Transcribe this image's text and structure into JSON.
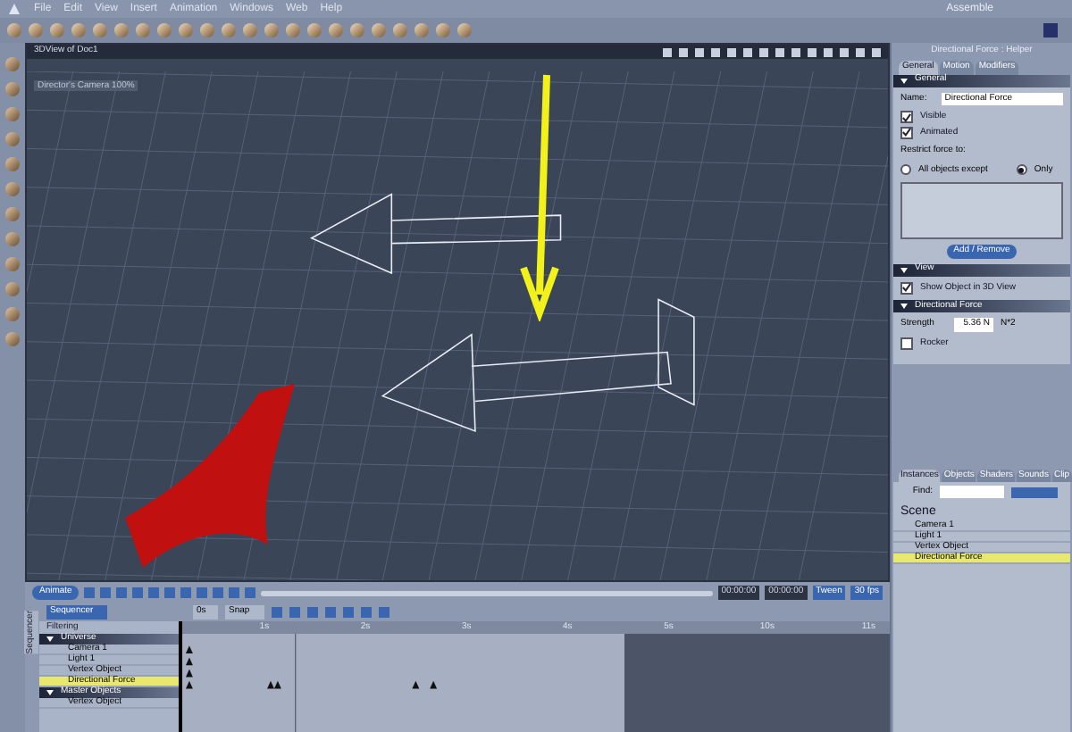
{
  "menu": [
    "File",
    "Edit",
    "View",
    "Insert",
    "Animation",
    "Windows",
    "Web",
    "Help"
  ],
  "room": "Assemble",
  "viewport": {
    "title": "3DView of Doc1",
    "camera": "Director's Camera 100%"
  },
  "properties": {
    "title": "Directional Force : Helper",
    "tabs": [
      {
        "label": "General",
        "selected": true
      },
      {
        "label": "Motion",
        "selected": false
      },
      {
        "label": "Modifiers",
        "selected": false
      }
    ],
    "general": {
      "heading": "General",
      "name_label": "Name:",
      "name_value": "Directional Force",
      "checks": [
        {
          "label": "Visible",
          "checked": true
        },
        {
          "label": "Animated",
          "checked": true
        }
      ],
      "restrict_label": "Restrict force to:",
      "radios": [
        {
          "label": "All objects except",
          "selected": false
        },
        {
          "label": "Only",
          "selected": true
        }
      ],
      "button": "Add / Remove"
    },
    "view": {
      "heading": "View",
      "checks": [
        {
          "label": "Show Object in 3D View",
          "checked": true
        }
      ]
    },
    "force": {
      "heading": "Directional Force",
      "strength_label": "Strength",
      "strength_value": "5.36 N",
      "unit": "N*2",
      "checks": [
        {
          "label": "Rocker",
          "checked": false
        }
      ]
    }
  },
  "browser": {
    "tabs": [
      {
        "label": "Instances",
        "selected": true
      },
      {
        "label": "Objects",
        "selected": false
      },
      {
        "label": "Shaders",
        "selected": false
      },
      {
        "label": "Sounds",
        "selected": false
      },
      {
        "label": "Clip",
        "selected": false
      }
    ],
    "find_label": "Find:",
    "tree": {
      "label": "Scene",
      "children": [
        {
          "label": "Camera 1",
          "selected": false
        },
        {
          "label": "Light 1",
          "selected": false
        },
        {
          "label": "Vertex Object",
          "selected": false
        },
        {
          "label": "Directional Force",
          "selected": true
        }
      ]
    }
  },
  "transport": {
    "animate": "Animate",
    "time_1": "00:00:00",
    "time_2": "00:00:00",
    "tween": "Tween",
    "fps": "30 fps"
  },
  "sequencer": {
    "tab": "Sequencer",
    "mode": "Sequencer",
    "filtering": "Filtering",
    "time": "0s",
    "snap": "Snap",
    "ruler": [
      "1s",
      "2s",
      "3s",
      "4s",
      "5s",
      "10s",
      "11s"
    ],
    "groups": [
      {
        "label": "Universe",
        "expanded": true,
        "children": [
          {
            "label": "Camera 1",
            "selected": false
          },
          {
            "label": "Light 1",
            "selected": false
          },
          {
            "label": "Vertex Object",
            "selected": false
          },
          {
            "label": "Directional Force",
            "selected": true
          }
        ]
      },
      {
        "label": "Master Objects",
        "expanded": true,
        "children": [
          {
            "label": "Vertex Object",
            "selected": false
          }
        ]
      }
    ]
  }
}
